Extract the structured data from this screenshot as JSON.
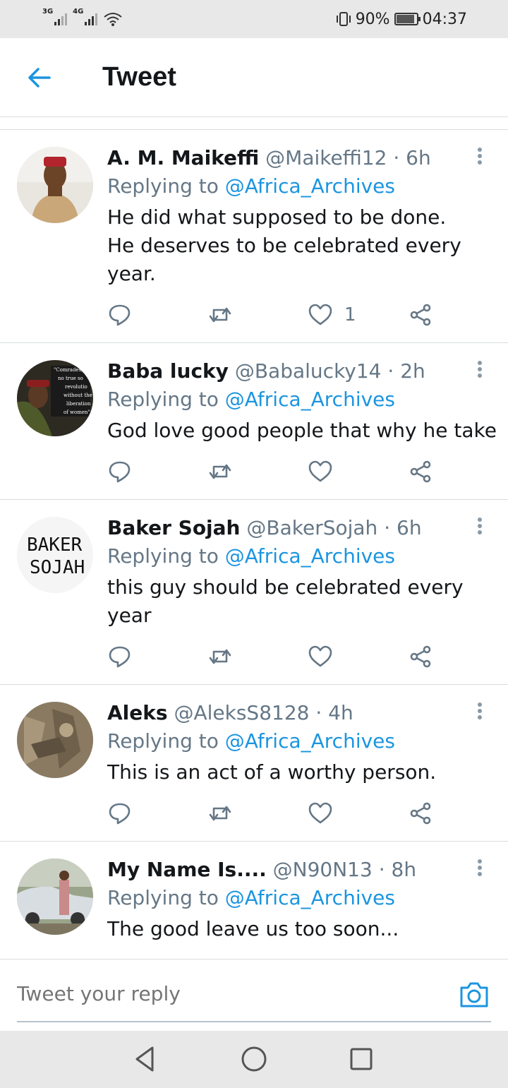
{
  "status_bar": {
    "network_1": "3G",
    "network_2": "4G",
    "battery_text": "90%",
    "battery_level": 0.9,
    "time": "04:37"
  },
  "header": {
    "title": "Tweet"
  },
  "tweets": [
    {
      "name": "A. M. Maikeffi",
      "handle": "@Maikeffi12",
      "time": "· 6h",
      "replying_label": "Replying to",
      "replying_handle": "@Africa_Archives",
      "text": "He did what supposed to be done.\nHe deserves to be celebrated every\nyear.",
      "likes": "1",
      "avatar_icon": "person-photo-avatar"
    },
    {
      "name": "Baba lucky",
      "handle": "@Babalucky14",
      "time": "· 2h",
      "replying_label": "Replying to",
      "replying_handle": "@Africa_Archives",
      "text": "God love good people that why he take",
      "likes": "",
      "avatar_icon": "quote-photo-avatar"
    },
    {
      "name": "Baker Sojah",
      "handle": "@BakerSojah",
      "time": "· 6h",
      "replying_label": "Replying to",
      "replying_handle": "@Africa_Archives",
      "text": "this guy should be celebrated every\nyear",
      "likes": "",
      "avatar_text_1": "BAKER",
      "avatar_text_2": "SOJAH"
    },
    {
      "name": "Aleks",
      "handle": "@AleksS8128",
      "time": "· 4h",
      "replying_label": "Replying to",
      "replying_handle": "@Africa_Archives",
      "text": "This is an act of a worthy person.",
      "likes": "",
      "avatar_icon": "relief-photo-avatar"
    },
    {
      "name": "My Name Is....",
      "handle": "@N90N13",
      "time": "· 8h",
      "replying_label": "Replying to",
      "replying_handle": "@Africa_Archives",
      "text": "The good leave us too soon...",
      "likes": "",
      "avatar_icon": "car-photo-avatar"
    }
  ],
  "composer": {
    "placeholder": "Tweet your reply"
  },
  "colors": {
    "accent": "#1b95e0",
    "muted": "#657786",
    "text": "#14171a",
    "divider": "#d9dde0"
  }
}
